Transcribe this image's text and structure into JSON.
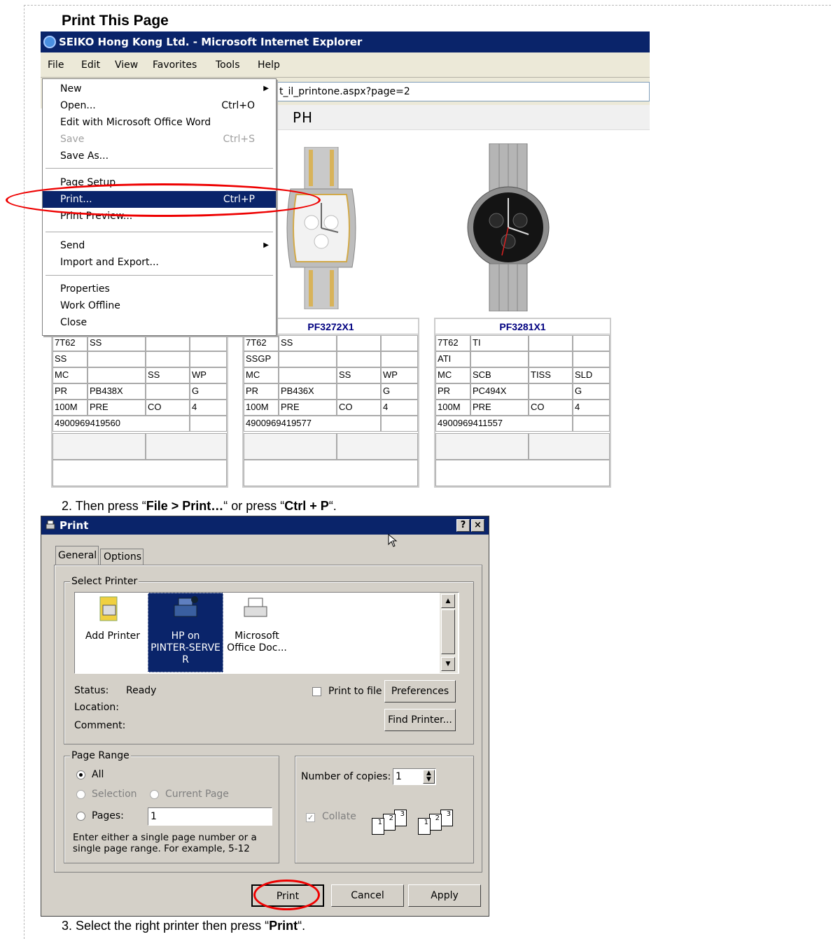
{
  "page_title": "Print This Page",
  "ie_window": {
    "title": "SEIKO Hong Kong Ltd. - Microsoft Internet Explorer",
    "menu": [
      "File",
      "Edit",
      "View",
      "Favorites",
      "Tools",
      "Help"
    ],
    "address_partial": "t_il_printone.aspx?page=2",
    "header_partial": "PH"
  },
  "file_menu": {
    "items": [
      {
        "label": "New",
        "shortcut": "",
        "submenu": true,
        "disabled": false
      },
      {
        "label": "Open...",
        "shortcut": "Ctrl+O",
        "submenu": false,
        "disabled": false
      },
      {
        "label": "Edit with Microsoft Office Word",
        "shortcut": "",
        "submenu": false,
        "disabled": false
      },
      {
        "label": "Save",
        "shortcut": "Ctrl+S",
        "submenu": false,
        "disabled": true
      },
      {
        "label": "Save As...",
        "shortcut": "",
        "submenu": false,
        "disabled": false
      },
      {
        "label": "Page Setup...",
        "shortcut": "",
        "submenu": false,
        "disabled": false
      },
      {
        "label": "Print...",
        "shortcut": "Ctrl+P",
        "submenu": false,
        "disabled": false,
        "selected": true
      },
      {
        "label": "Print Preview...",
        "shortcut": "",
        "submenu": false,
        "disabled": false
      },
      {
        "label": "Send",
        "shortcut": "",
        "submenu": true,
        "disabled": false
      },
      {
        "label": "Import and Export...",
        "shortcut": "",
        "submenu": false,
        "disabled": false
      },
      {
        "label": "Properties",
        "shortcut": "",
        "submenu": false,
        "disabled": false
      },
      {
        "label": "Work Offline",
        "shortcut": "",
        "submenu": false,
        "disabled": false
      },
      {
        "label": "Close",
        "shortcut": "",
        "submenu": false,
        "disabled": false
      }
    ]
  },
  "products": [
    {
      "model": "",
      "rows": [
        [
          "7T62",
          "SS",
          "",
          ""
        ],
        [
          "SS",
          "",
          "",
          ""
        ],
        [
          "MC",
          "",
          "SS",
          "WP"
        ],
        [
          "PR",
          "PB438X",
          "",
          "G"
        ],
        [
          "100M",
          "PRE",
          "CO",
          "4"
        ],
        [
          "4900969419560",
          "",
          "",
          ""
        ]
      ]
    },
    {
      "model": "PF3272X1",
      "rows": [
        [
          "7T62",
          "SS",
          "",
          ""
        ],
        [
          "SSGP",
          "",
          "",
          ""
        ],
        [
          "MC",
          "",
          "SS",
          "WP"
        ],
        [
          "PR",
          "PB436X",
          "",
          "G"
        ],
        [
          "100M",
          "PRE",
          "CO",
          "4"
        ],
        [
          "4900969419577",
          "",
          "",
          ""
        ]
      ]
    },
    {
      "model": "PF3281X1",
      "rows": [
        [
          "7T62",
          "TI",
          "",
          ""
        ],
        [
          "ATI",
          "",
          "",
          ""
        ],
        [
          "MC",
          "SCB",
          "TISS",
          "SLD"
        ],
        [
          "PR",
          "PC494X",
          "",
          "G"
        ],
        [
          "100M",
          "PRE",
          "CO",
          "4"
        ],
        [
          "4900969411557",
          "",
          "",
          ""
        ]
      ]
    }
  ],
  "step2": {
    "prefix": "2.  Then press “",
    "b1": "File > Print…",
    "mid": "“ or press “",
    "b2": "Ctrl + P",
    "suffix": "“."
  },
  "print_dialog": {
    "title": "Print",
    "help_btn": "?",
    "close_btn": "×",
    "tabs": [
      "General",
      "Options"
    ],
    "select_printer_label": "Select Printer",
    "printers": [
      "Add Printer",
      "HP on PINTER-SERVE R",
      "Microsoft Office Doc..."
    ],
    "printer_lines": [
      [
        "Add Printer"
      ],
      [
        "HP on",
        "PINTER-SERVE",
        "R"
      ],
      [
        "Microsoft",
        "Office Doc..."
      ]
    ],
    "status_label": "Status:",
    "status_value": "Ready",
    "location_label": "Location:",
    "comment_label": "Comment:",
    "print_to_file": "Print to file",
    "preferences": "Preferences",
    "find_printer": "Find Printer...",
    "page_range_label": "Page Range",
    "all": "All",
    "selection": "Selection",
    "current_page": "Current Page",
    "pages": "Pages:",
    "pages_value": "1",
    "hint": "Enter either a single page number or a single page range.  For example, 5-12",
    "copies_label": "Number of copies:",
    "copies_value": "1",
    "collate": "Collate",
    "print_btn": "Print",
    "cancel_btn": "Cancel",
    "apply_btn": "Apply"
  },
  "step3": {
    "prefix": "3.  Select the right printer then press “",
    "b": "Print",
    "suffix": "“."
  }
}
